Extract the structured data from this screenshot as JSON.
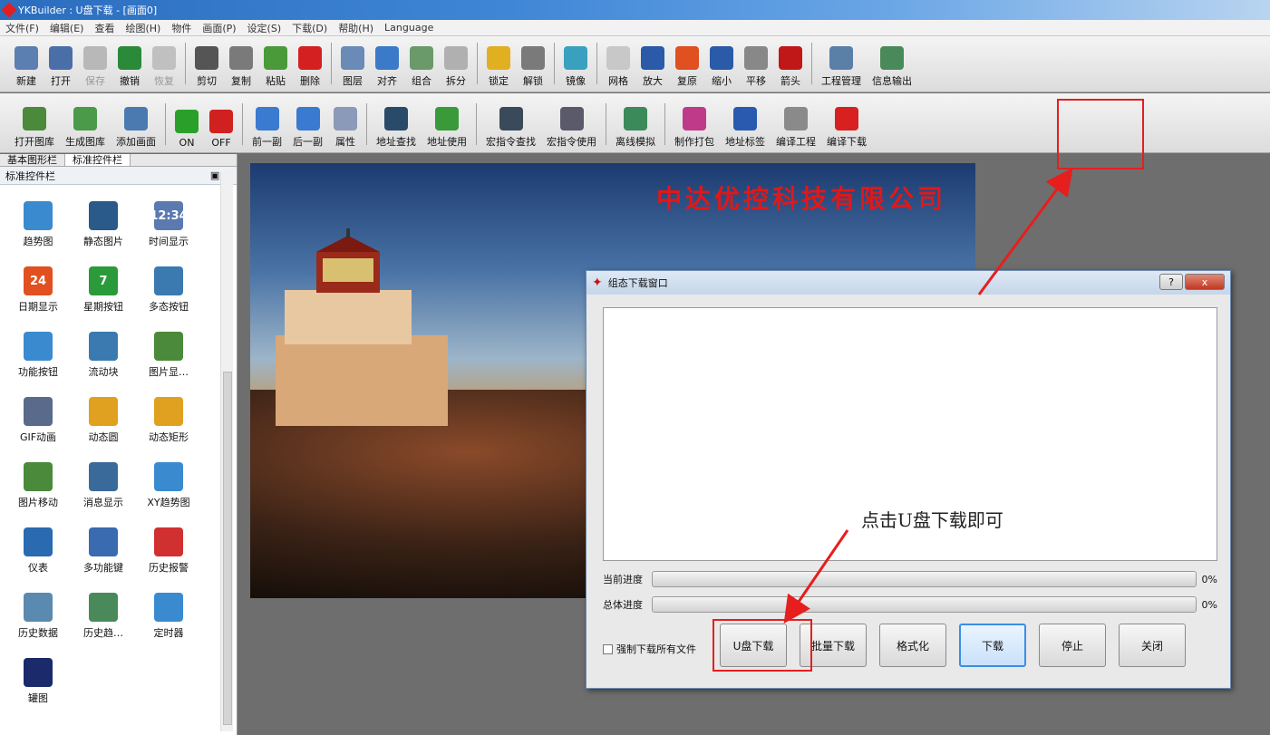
{
  "window": {
    "title": "YKBuilder : U盘下载 - [画面0]"
  },
  "menu": [
    "文件(F)",
    "编辑(E)",
    "查看",
    "绘图(H)",
    "物件",
    "画面(P)",
    "设定(S)",
    "下载(D)",
    "帮助(H)",
    "Language"
  ],
  "toolbar1": [
    {
      "label": "新建",
      "icon": "new-icon",
      "color": "#5a7fb0"
    },
    {
      "label": "打开",
      "icon": "open-icon",
      "color": "#4a6fa8"
    },
    {
      "label": "保存",
      "icon": "save-icon",
      "color": "#b8b8b8",
      "disabled": true
    },
    {
      "label": "撤销",
      "icon": "undo-icon",
      "color": "#2a8a3a"
    },
    {
      "label": "恢复",
      "icon": "redo-icon",
      "color": "#c0c0c0",
      "disabled": true
    },
    {
      "label": "剪切",
      "icon": "cut-icon",
      "color": "#555555"
    },
    {
      "label": "复制",
      "icon": "copy-icon",
      "color": "#7a7a7a"
    },
    {
      "label": "粘贴",
      "icon": "paste-icon",
      "color": "#4a9a3a"
    },
    {
      "label": "删除",
      "icon": "delete-icon",
      "color": "#d42020"
    },
    {
      "label": "图层",
      "icon": "layer-icon",
      "color": "#6a8ab8"
    },
    {
      "label": "对齐",
      "icon": "align-icon",
      "color": "#3a7ac8"
    },
    {
      "label": "组合",
      "icon": "group-icon",
      "color": "#6a9a6a"
    },
    {
      "label": "拆分",
      "icon": "split-icon",
      "color": "#b0b0b0"
    },
    {
      "label": "锁定",
      "icon": "lock-icon",
      "color": "#e0b020"
    },
    {
      "label": "解锁",
      "icon": "unlock-icon",
      "color": "#7a7a7a"
    },
    {
      "label": "镜像",
      "icon": "mirror-icon",
      "color": "#3aa0c0"
    },
    {
      "label": "网格",
      "icon": "grid-icon",
      "color": "#c8c8c8"
    },
    {
      "label": "放大",
      "icon": "zoom-in-icon",
      "color": "#2a5aa8"
    },
    {
      "label": "复原",
      "icon": "restore-icon",
      "color": "#e05020"
    },
    {
      "label": "缩小",
      "icon": "zoom-out-icon",
      "color": "#2a5aa8"
    },
    {
      "label": "平移",
      "icon": "pan-icon",
      "color": "#888888"
    },
    {
      "label": "箭头",
      "icon": "arrow-pointer-icon",
      "color": "#c01818"
    },
    {
      "label": "工程管理",
      "icon": "project-manage-icon",
      "color": "#5a80a8"
    },
    {
      "label": "信息输出",
      "icon": "info-output-icon",
      "color": "#4a8a5a"
    }
  ],
  "toolbar2": [
    {
      "label": "打开图库",
      "icon": "open-gallery-icon",
      "color": "#4a8a3a"
    },
    {
      "label": "生成图库",
      "icon": "make-gallery-icon",
      "color": "#4a9a4a"
    },
    {
      "label": "添加画面",
      "icon": "add-screen-icon",
      "color": "#4a7ab0"
    },
    {
      "label": "ON",
      "icon": "on-icon",
      "color": "#2aa02a"
    },
    {
      "label": "OFF",
      "icon": "off-icon",
      "color": "#d02020"
    },
    {
      "label": "前一副",
      "icon": "prev-icon",
      "color": "#3a7ad0"
    },
    {
      "label": "后一副",
      "icon": "next-icon",
      "color": "#3a7ad0"
    },
    {
      "label": "属性",
      "icon": "property-icon",
      "color": "#8a9ab8"
    },
    {
      "label": "地址查找",
      "icon": "address-search-icon",
      "color": "#2a4a6a"
    },
    {
      "label": "地址使用",
      "icon": "address-use-icon",
      "color": "#3a9a3a"
    },
    {
      "label": "宏指令查找",
      "icon": "macro-search-icon",
      "color": "#3a4a5a"
    },
    {
      "label": "宏指令使用",
      "icon": "macro-use-icon",
      "color": "#5a5a6a"
    },
    {
      "label": "离线模拟",
      "icon": "offline-sim-icon",
      "color": "#3a8a5a"
    },
    {
      "label": "制作打包",
      "icon": "package-icon",
      "color": "#c03a8a"
    },
    {
      "label": "地址标签",
      "icon": "address-tag-icon",
      "color": "#2a5ab0"
    },
    {
      "label": "编译工程",
      "icon": "compile-icon",
      "color": "#8a8a8a"
    },
    {
      "label": "编译下载",
      "icon": "compile-download-icon",
      "color": "#d82020"
    }
  ],
  "panel": {
    "tabs": [
      "基本图形栏",
      "标准控件栏"
    ],
    "header": "标准控件栏",
    "items": [
      {
        "label": "趋势图",
        "icon": "trend-chart-icon",
        "color": "#3a8ad0"
      },
      {
        "label": "静态图片",
        "icon": "static-image-icon",
        "color": "#2a5a8a"
      },
      {
        "label": "时间显示",
        "icon": "time-display-icon",
        "color": "#5a7ab0",
        "glyph": "12:34"
      },
      {
        "label": "日期显示",
        "icon": "date-display-icon",
        "color": "#e05020",
        "glyph": "24"
      },
      {
        "label": "星期按钮",
        "icon": "weekday-button-icon",
        "color": "#2a9a3a",
        "glyph": "7"
      },
      {
        "label": "多态按钮",
        "icon": "multistate-button-icon",
        "color": "#3a7ab0"
      },
      {
        "label": "功能按钮",
        "icon": "function-button-icon",
        "color": "#3a8ad0"
      },
      {
        "label": "流动块",
        "icon": "flow-block-icon",
        "color": "#3a7ab0"
      },
      {
        "label": "图片显…",
        "icon": "image-display-icon",
        "color": "#4a8a3a"
      },
      {
        "label": "GIF动画",
        "icon": "gif-animation-icon",
        "color": "#5a6a8a"
      },
      {
        "label": "动态圆",
        "icon": "dynamic-circle-icon",
        "color": "#e0a020"
      },
      {
        "label": "动态矩形",
        "icon": "dynamic-rect-icon",
        "color": "#e0a020"
      },
      {
        "label": "图片移动",
        "icon": "image-move-icon",
        "color": "#4a8a3a"
      },
      {
        "label": "消息显示",
        "icon": "message-display-icon",
        "color": "#3a6a9a"
      },
      {
        "label": "XY趋势图",
        "icon": "xy-trend-icon",
        "color": "#3a8ad0"
      },
      {
        "label": "仪表",
        "icon": "gauge-icon",
        "color": "#2a6ab0"
      },
      {
        "label": "多功能键",
        "icon": "multi-function-key-icon",
        "color": "#3a6ab0"
      },
      {
        "label": "历史报警",
        "icon": "history-alarm-icon",
        "color": "#d03030"
      },
      {
        "label": "历史数据",
        "icon": "history-data-icon",
        "color": "#5a8ab0"
      },
      {
        "label": "历史趋…",
        "icon": "history-trend-icon",
        "color": "#4a8a5a"
      },
      {
        "label": "定时器",
        "icon": "timer-icon",
        "color": "#3a8ad0"
      },
      {
        "label": "罐图",
        "icon": "tank-icon",
        "color": "#1a2a6a"
      }
    ]
  },
  "canvas": {
    "company": "中达优控科技有限公司"
  },
  "dialog": {
    "title": "组态下载窗口",
    "help": "?",
    "close": "x",
    "hint": "点击U盘下载即可",
    "current_label": "当前进度",
    "current_value": "0%",
    "current_fraction": 0,
    "total_label": "总体进度",
    "total_value": "0%",
    "total_fraction": 0,
    "force_label": "强制下载所有文件",
    "buttons": [
      "U盘下载",
      "批量下载",
      "格式化",
      "下载",
      "停止",
      "关闭"
    ]
  },
  "colors": {
    "highlight": "#e61e1e",
    "accent": "#3a8ee6"
  }
}
